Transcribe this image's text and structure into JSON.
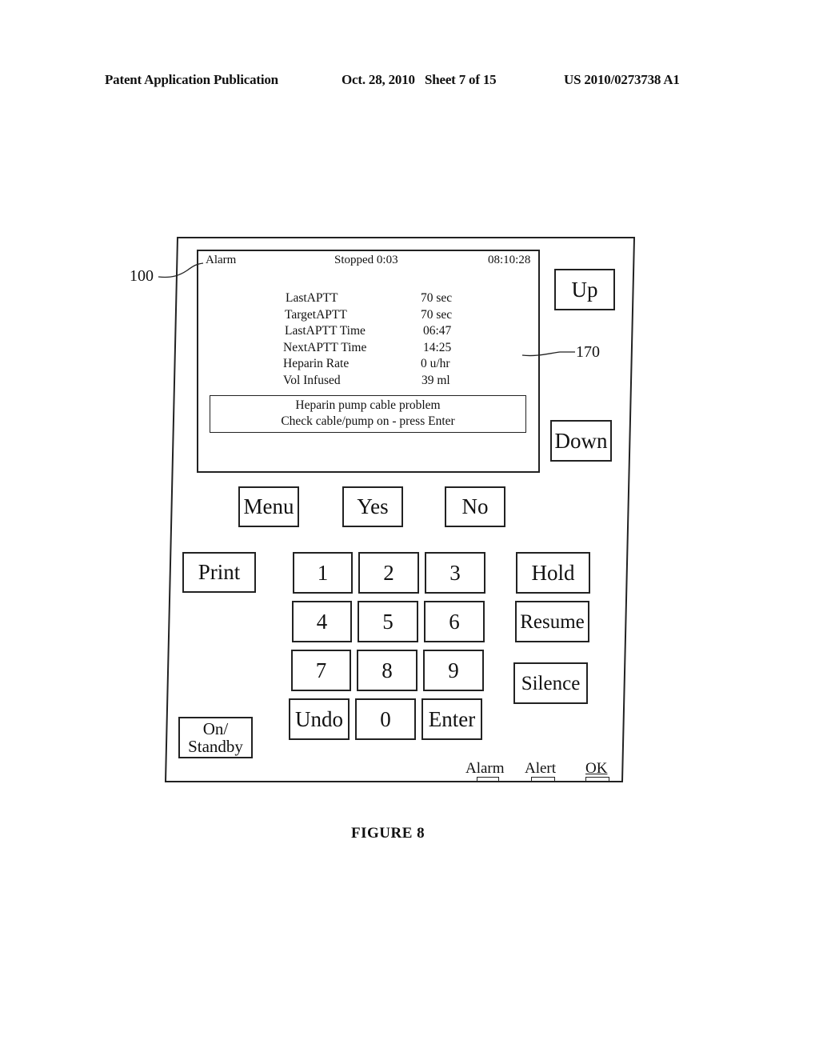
{
  "header": {
    "publication": "Patent Application Publication",
    "date_sheet": "Oct. 28, 2010   Sheet 7 of 15",
    "number": "US 2010/0273738 A1"
  },
  "references": {
    "device": "100",
    "screen": "170"
  },
  "screen": {
    "mode": "Alarm",
    "status": "Stopped 0:03",
    "clock": "08:10:28",
    "rows": [
      {
        "label": "LastAPTT",
        "value": "70 sec"
      },
      {
        "label": "TargetAPTT",
        "value": "70 sec"
      },
      {
        "label": "LastAPTT Time",
        "value": "06:47"
      },
      {
        "label": "NextAPTT Time",
        "value": "14:25"
      },
      {
        "label": "Heparin Rate",
        "value": "0 u/hr"
      },
      {
        "label": "Vol Infused",
        "value": "39 ml"
      }
    ],
    "message": {
      "line1": "Heparin pump cable problem",
      "line2": "Check cable/pump on - press Enter"
    }
  },
  "buttons": {
    "up": "Up",
    "down": "Down",
    "menu": "Menu",
    "yes": "Yes",
    "no": "No",
    "print": "Print",
    "hold": "Hold",
    "resume": "Resume",
    "silence": "Silence",
    "on_standby_line1": "On/",
    "on_standby_line2": "Standby",
    "keypad": [
      "1",
      "2",
      "3",
      "4",
      "5",
      "6",
      "7",
      "8",
      "9",
      "Undo",
      "0",
      "Enter"
    ]
  },
  "indicators": {
    "alarm": "Alarm",
    "alert": "Alert",
    "ok": "OK"
  },
  "caption": "FIGURE 8"
}
